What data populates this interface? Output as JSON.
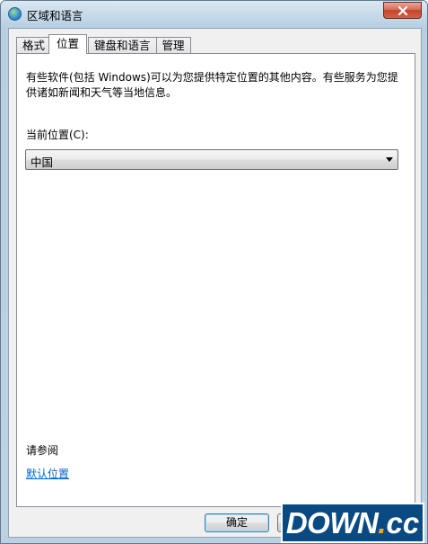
{
  "window": {
    "title": "区域和语言"
  },
  "tabs": [
    {
      "label": "格式"
    },
    {
      "label": "位置"
    },
    {
      "label": "键盘和语言"
    },
    {
      "label": "管理"
    }
  ],
  "location_tab": {
    "description": "有些软件(包括 Windows)可以为您提供特定位置的其他内容。有些服务为您提供诸如新闻和天气等当地信息。",
    "current_location_label": "当前位置(C):",
    "current_location_value": "中国",
    "see_also_label": "请参阅",
    "default_location_link": "默认位置"
  },
  "buttons": {
    "ok": "确定",
    "cancel": ""
  },
  "watermark": {
    "main": "DOWN",
    "dot": ".",
    "suffix": "cc"
  },
  "icons": {
    "title": "globe-icon",
    "close": "close-icon",
    "dropdown": "chevron-down-icon"
  },
  "colors": {
    "link": "#0066cc",
    "close_button": "#c2432b",
    "watermark_bg": "#0a4a83",
    "watermark_dot": "#f5a623"
  }
}
